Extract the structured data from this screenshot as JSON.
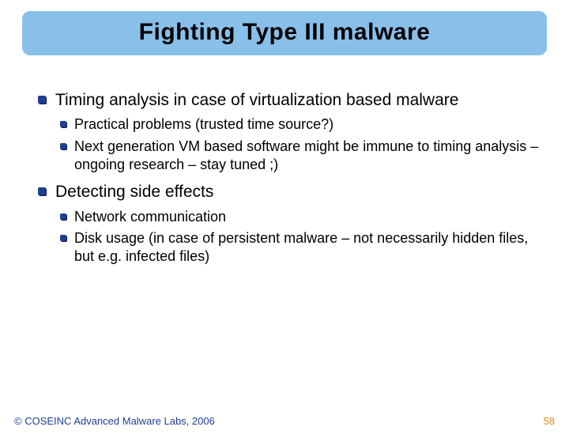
{
  "title": "Fighting Type III malware",
  "bullets": [
    {
      "text": "Timing analysis in case of virtualization based malware",
      "children": [
        {
          "text": "Practical problems (trusted time source?)"
        },
        {
          "text": "Next generation VM based software might be immune to timing analysis – ongoing research – stay tuned ;)"
        }
      ]
    },
    {
      "text": "Detecting side effects",
      "children": [
        {
          "text": "Network communication"
        },
        {
          "text": "Disk usage (in case of persistent malware – not necessarily hidden files, but e.g. infected files)"
        }
      ]
    }
  ],
  "footer": {
    "copyright": "© COSEINC Advanced Malware Labs, 2006",
    "page": "58"
  }
}
